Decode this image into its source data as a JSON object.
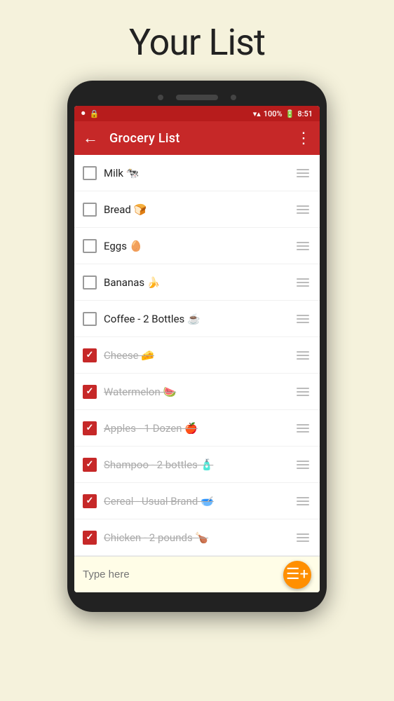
{
  "page": {
    "title": "Your List"
  },
  "statusBar": {
    "leftIcons": [
      "⏺",
      "🔒"
    ],
    "signal": "▼▲",
    "battery": "100%",
    "batteryIcon": "🔋",
    "time": "8:51"
  },
  "appBar": {
    "backLabel": "←",
    "title": "Grocery List",
    "moreLabel": "⋮"
  },
  "groceryItems": [
    {
      "id": 1,
      "text": "Milk 🐄",
      "checked": false
    },
    {
      "id": 2,
      "text": "Bread 🍞",
      "checked": false
    },
    {
      "id": 3,
      "text": "Eggs 🥚",
      "checked": false
    },
    {
      "id": 4,
      "text": "Bananas 🍌",
      "checked": false
    },
    {
      "id": 5,
      "text": "Coffee - 2 Bottles ☕",
      "checked": false
    },
    {
      "id": 6,
      "text": "Cheese 🧀",
      "checked": true
    },
    {
      "id": 7,
      "text": "Watermelon 🍉",
      "checked": true
    },
    {
      "id": 8,
      "text": "Apples - 1 Dozen 🍎",
      "checked": true
    },
    {
      "id": 9,
      "text": "Shampoo - 2 bottles 🧴",
      "checked": true
    },
    {
      "id": 10,
      "text": "Cereal - Usual Brand 🥣",
      "checked": true
    },
    {
      "id": 11,
      "text": "Chicken - 2 pounds 🍗",
      "checked": true
    }
  ],
  "inputBar": {
    "placeholder": "Type here"
  },
  "fabButton": {
    "label": "≡+"
  }
}
